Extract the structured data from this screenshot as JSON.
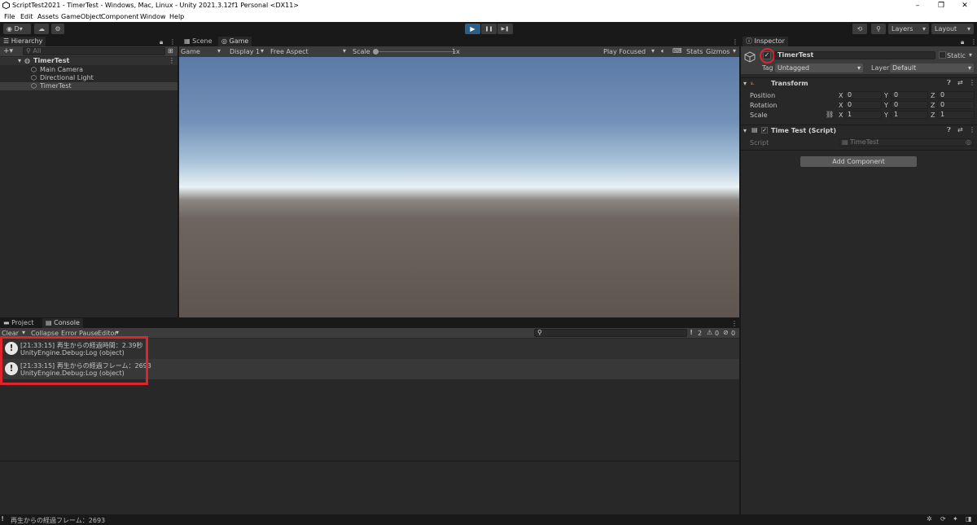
{
  "window": {
    "title": "ScriptTest2021 - TimerTest - Windows, Mac, Linux - Unity 2021.3.12f1 Personal <DX11>",
    "minimize": "–",
    "maximize": "❐",
    "close": "✕"
  },
  "menu": [
    "File",
    "Edit",
    "Assets",
    "GameObject",
    "Component",
    "Window",
    "Help"
  ],
  "toolbar": {
    "account": "D",
    "account_caret": "▾",
    "layers": "Layers",
    "layout": "Layout",
    "play": "▶",
    "pause": "❚❚",
    "step": "▶❚"
  },
  "hierarchy": {
    "tab": "Hierarchy",
    "add": "+▾",
    "search_placeholder": "All",
    "scene": "TimerTest",
    "items": [
      "Main Camera",
      "Directional Light",
      "TimerTest"
    ]
  },
  "game": {
    "tabs": [
      "Scene",
      "Game"
    ],
    "display_mode": "Game",
    "display": "Display 1",
    "aspect": "Free Aspect",
    "scale_label": "Scale",
    "scale_value": "1x",
    "play_mode": "Play Focused",
    "stats": "Stats",
    "gizmos": "Gizmos"
  },
  "inspector": {
    "tab": "Inspector",
    "object_name": "TimerTest",
    "active_check": "✓",
    "static_label": "Static",
    "tag_label": "Tag",
    "tag_value": "Untagged",
    "layer_label": "Layer",
    "layer_value": "Default",
    "transform": {
      "title": "Transform",
      "rows": [
        {
          "label": "Position",
          "x": "0",
          "y": "0",
          "z": "0"
        },
        {
          "label": "Rotation",
          "x": "0",
          "y": "0",
          "z": "0"
        },
        {
          "label": "Scale",
          "x": "1",
          "y": "1",
          "z": "1"
        }
      ],
      "axis_x": "X",
      "axis_y": "Y",
      "axis_z": "Z"
    },
    "script_component": {
      "title": "Time Test (Script)",
      "check": "✓",
      "script_label": "Script",
      "script_value": "TimeTest"
    },
    "add_component": "Add Component"
  },
  "console": {
    "tabs": [
      "Project",
      "Console"
    ],
    "clear": "Clear",
    "collapse": "Collapse",
    "error_pause": "Error Pause",
    "editor": "Editor",
    "log_count": "2",
    "warn_count": "0",
    "error_count": "0",
    "entries": [
      {
        "line1": "[21:33:15] 再生からの経過時間：2.39秒",
        "line2": "UnityEngine.Debug:Log (object)"
      },
      {
        "line1": "[21:33:15] 再生からの経過フレーム：2693",
        "line2": "UnityEngine.Debug:Log (object)"
      }
    ]
  },
  "status": {
    "message": "再生からの経過フレーム：2693"
  },
  "colors": {
    "accent": "#2a5f8a",
    "highlight": "#e0242c",
    "panel": "#282828"
  }
}
